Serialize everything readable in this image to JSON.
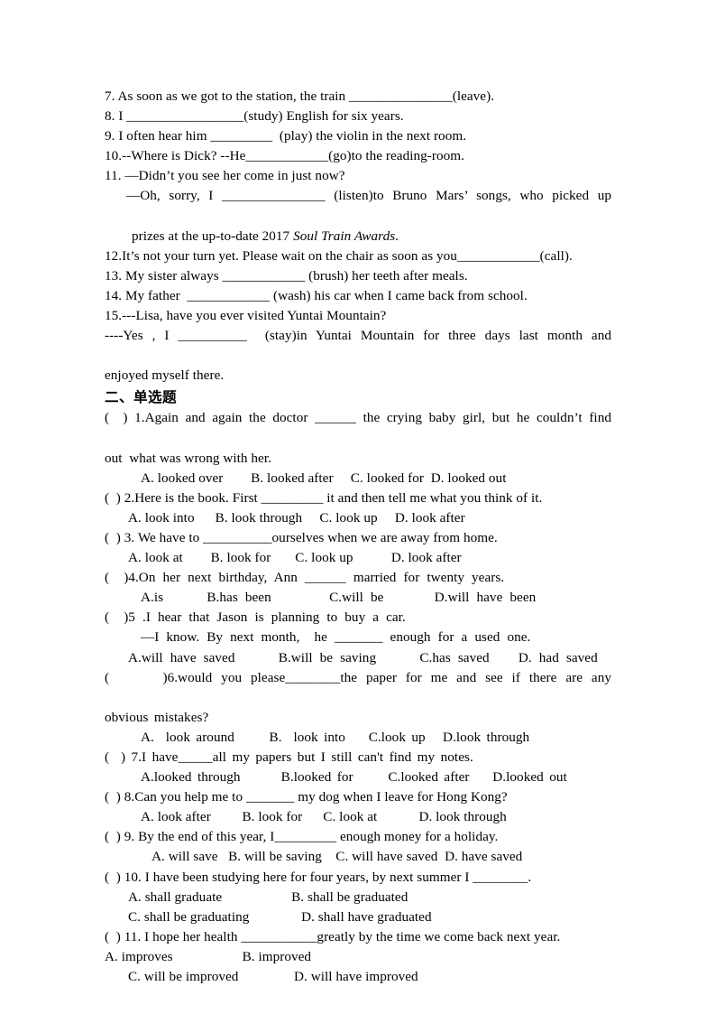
{
  "document": {
    "page_background": "#ffffff",
    "text_color": "#000000",
    "fill_in_section": {
      "items": [
        {
          "id": "item-7",
          "lines": [
            "7. As soon as we got to the station, the train _______________(leave)."
          ]
        },
        {
          "id": "item-8",
          "lines": [
            "8. I _________________(study) English for six years."
          ]
        },
        {
          "id": "item-9",
          "lines": [
            "9. I often hear him _________  (play) the violin in the next room."
          ]
        },
        {
          "id": "item-10",
          "lines": [
            "10.--Where is Dick? --He____________(go)to the reading-room."
          ]
        },
        {
          "id": "item-11",
          "lines": [
            "11. —Didn’t you see her come in just now?",
            "—Oh, sorry, I _______________ (listen)to Bruno Mars’ songs, who picked up",
            "prizes at the up-to-date 2017 ",
            "Soul Train Awards",
            "."
          ],
          "italic_part": "Soul Train Awards"
        },
        {
          "id": "item-12",
          "lines": [
            "12.It’s not your turn yet. Please wait on the chair as soon as you____________(call)."
          ]
        },
        {
          "id": "item-13",
          "lines": [
            "13. My sister always ____________ (brush) her teeth after meals."
          ]
        },
        {
          "id": "item-14",
          "lines": [
            "14. My father  ____________ (wash) his car when I came back from school."
          ]
        },
        {
          "id": "item-15",
          "lines": [
            "15.---Lisa, have you ever visited Yuntai Mountain?",
            "----Yes , I __________  (stay)in Yuntai Mountain for three days last month and",
            "enjoyed myself there."
          ]
        }
      ]
    },
    "section_heading": "二、单选题",
    "multiple_choice": {
      "questions": [
        {
          "id": "mcq-1",
          "stem_lines": [
            "(  ) 1.Again and again the doctor ______ the crying baby girl, but he couldn’t find",
            "out  what was wrong with her."
          ],
          "options_lines": [
            "A. looked over        B. looked after     C. looked for  D. looked out"
          ]
        },
        {
          "id": "mcq-2",
          "stem_lines": [
            "(  ) 2.Here is the book. First _________ it and then tell me what you think of it."
          ],
          "options_lines": [
            "A. look into      B. look through     C. look up     D. look after"
          ]
        },
        {
          "id": "mcq-3",
          "stem_lines": [
            "(  ) 3. We have to __________ourselves when we are away from home."
          ],
          "options_lines": [
            "A. look at        B. look for       C. look up           D. look after"
          ]
        },
        {
          "id": "mcq-4",
          "stem_lines": [
            "(  )4.On her next birthday, Ann ______ married for twenty years."
          ],
          "options_lines": [
            "A.is      B.has been        C.will be       D.will have been"
          ]
        },
        {
          "id": "mcq-5",
          "stem_lines": [
            "(  )5 .I hear that Jason is planning to buy a car.",
            "—I know. By next month,  he _______ enough for a used one."
          ],
          "options_lines": [
            "A.will have saved      B.will be saving      C.has saved    D. had saved"
          ]
        },
        {
          "id": "mcq-6",
          "stem_lines": [
            "(      )6.would you please________the paper for me and see if there are any",
            "obvious mistakes?"
          ],
          "options_lines": [
            "A.  look around      B.  look into    C.look up   D.look through"
          ]
        },
        {
          "id": "mcq-7",
          "stem_lines": [
            "(  ) 7.I have_____all my papers but I still can't find my notes."
          ],
          "options_lines": [
            "A.looked through       B.looked for      C.looked after    D.looked out"
          ]
        },
        {
          "id": "mcq-8",
          "stem_lines": [
            "(  ) 8.Can you help me to _______ my dog when I leave for Hong Kong?"
          ],
          "options_lines": [
            "A. look after         B. look for      C. look at            D. look through"
          ]
        },
        {
          "id": "mcq-9",
          "stem_lines": [
            "(  ) 9. By the end of this year, I_________ enough money for a holiday."
          ],
          "options_lines": [
            "A. will save   B. will be saving    C. will have saved  D. have saved"
          ]
        },
        {
          "id": "mcq-10",
          "stem_lines": [
            "(  ) 10. I have been studying here for four years, by next summer I ________."
          ],
          "options_lines": [
            "A. shall graduate                    B. shall be graduated",
            "C. shall be graduating               D. shall have graduated"
          ]
        },
        {
          "id": "mcq-11",
          "stem_lines": [
            "(  ) 11. I hope her health ___________greatly by the time we come back next year."
          ],
          "options_lines": [
            "A. improves                    B. improved",
            "C. will be improved                D. will have improved"
          ],
          "options_first_line_flush_left": true
        }
      ]
    }
  }
}
